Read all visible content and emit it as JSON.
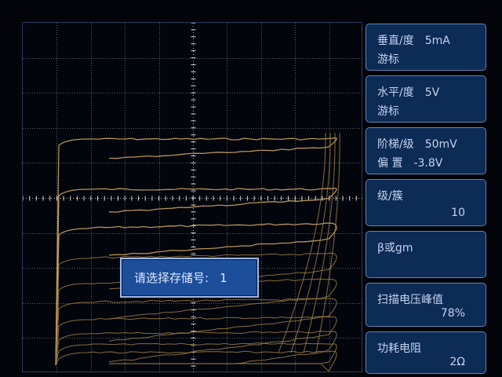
{
  "dialog": {
    "prompt": "请选择存储号:",
    "value": "1"
  },
  "settings": {
    "vertical": {
      "label": "垂直/度",
      "value": "5mA",
      "sub": "游标"
    },
    "horizontal": {
      "label": "水平/度",
      "value": "5V",
      "sub": "游标"
    },
    "step": {
      "label": "阶梯/级",
      "value": "50mV",
      "offset_label": "偏  置",
      "offset_value": "-3.8V"
    },
    "stages": {
      "label": "级/簇",
      "value": "10"
    },
    "beta": {
      "label": "β或gm"
    },
    "sweep": {
      "label": "扫描电压峰值",
      "value": "78%"
    },
    "power_resistor": {
      "label": "功耗电阻",
      "value": "2Ω"
    }
  },
  "colors": {
    "trace": "#c8a45e",
    "panel": "#0c2b55",
    "dialog": "#1c4e9a"
  }
}
